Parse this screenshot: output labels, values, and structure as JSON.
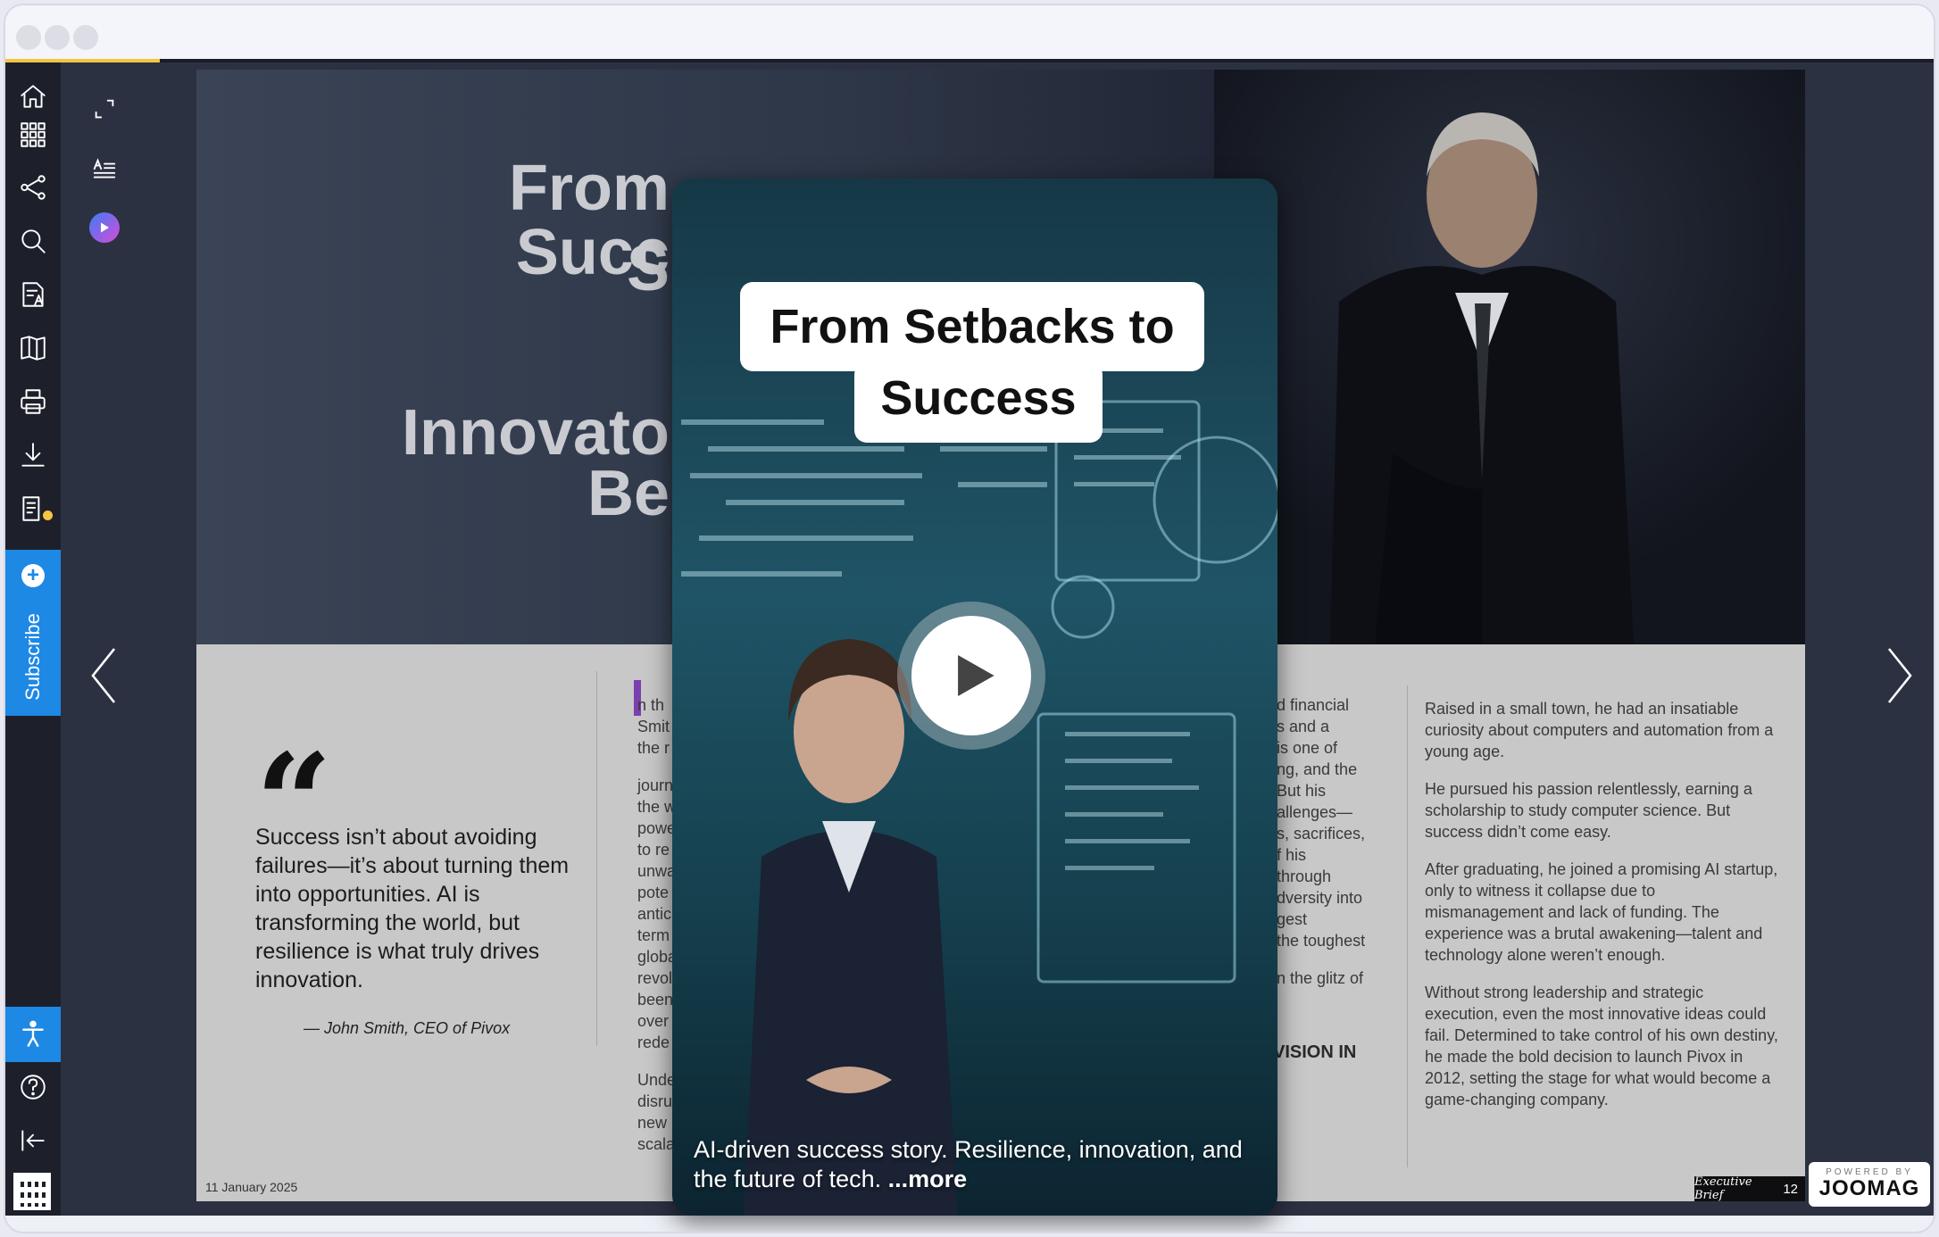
{
  "window": {
    "dots": [
      "close",
      "minimize",
      "zoom"
    ]
  },
  "sidebar": {
    "items": [
      {
        "name": "home-icon"
      },
      {
        "name": "grid-icon"
      },
      {
        "name": "share-icon"
      },
      {
        "name": "search-icon"
      },
      {
        "name": "text-view-icon"
      },
      {
        "name": "book-icon"
      },
      {
        "name": "print-icon"
      },
      {
        "name": "download-icon"
      },
      {
        "name": "notes-icon"
      }
    ],
    "subscribe_label": "Subscribe",
    "bottom": [
      {
        "name": "accessibility-icon"
      },
      {
        "name": "help-icon"
      },
      {
        "name": "collapse-icon"
      },
      {
        "name": "qr-code-icon"
      }
    ]
  },
  "toolbar": {
    "items": [
      "fullscreen-icon",
      "text-mode-icon",
      "video-stories-icon"
    ]
  },
  "progress": {
    "fraction": 0.08
  },
  "magazine": {
    "hero_title_lines": [
      "From S",
      "Succ",
      "Innovato",
      "Be"
    ],
    "quote": "Success isn’t about avoiding failures—it’s about turning them into opportunities. AI is transforming the world, but resilience is what truly drives innovation.",
    "attribution": "— John Smith, CEO of Pivox",
    "col2_frags": [
      "n th",
      "Smit",
      "the r",
      "journ",
      "the w",
      "powe",
      "to re",
      "unwa",
      "pote",
      "antic",
      "term",
      "globa",
      "revol",
      "been",
      "over",
      "rede",
      "Unde",
      "disru",
      "new",
      "scalability, and human-centric design."
    ],
    "col3_frags": [
      "d financial",
      "s and a",
      "is one of",
      "ng, and the",
      "But his",
      "allenges—",
      "s, sacrifices,",
      "f his",
      "through",
      "dversity into",
      "gest",
      "the toughest",
      "n the glitz of"
    ],
    "col3_heading": "VISION IN",
    "col4_paragraphs": [
      "Raised in a small town, he had an insatiable curiosity about computers and automation from a young age.",
      "He pursued his passion relentlessly, earning a scholarship to study computer science. But success didn’t come easy.",
      "After graduating, he joined a promising AI startup, only to witness it collapse due to mismanagement and lack of funding. The experience was a brutal awakening—talent and technology alone weren’t enough.",
      "Without strong leadership and strategic execution, even the most innovative ideas could fail. Determined to take control of his own destiny, he made the bold decision to launch Pivox in 2012, setting the stage for what would become a game-changing company."
    ],
    "date": "11 January 2025",
    "brand": "Executive Brief",
    "page_number": "12"
  },
  "video": {
    "title_line1": "From Setbacks to",
    "title_line2": "Success",
    "caption": "AI-driven success story. Resilience, innovation, and the future of tech.",
    "more_label": "...more"
  },
  "joomag": {
    "powered_by": "POWERED BY",
    "name": "JOOMAG"
  },
  "colors": {
    "accent": "#1e88e5",
    "progress": "#f5c542",
    "dropcap": "#7b3fb0"
  }
}
